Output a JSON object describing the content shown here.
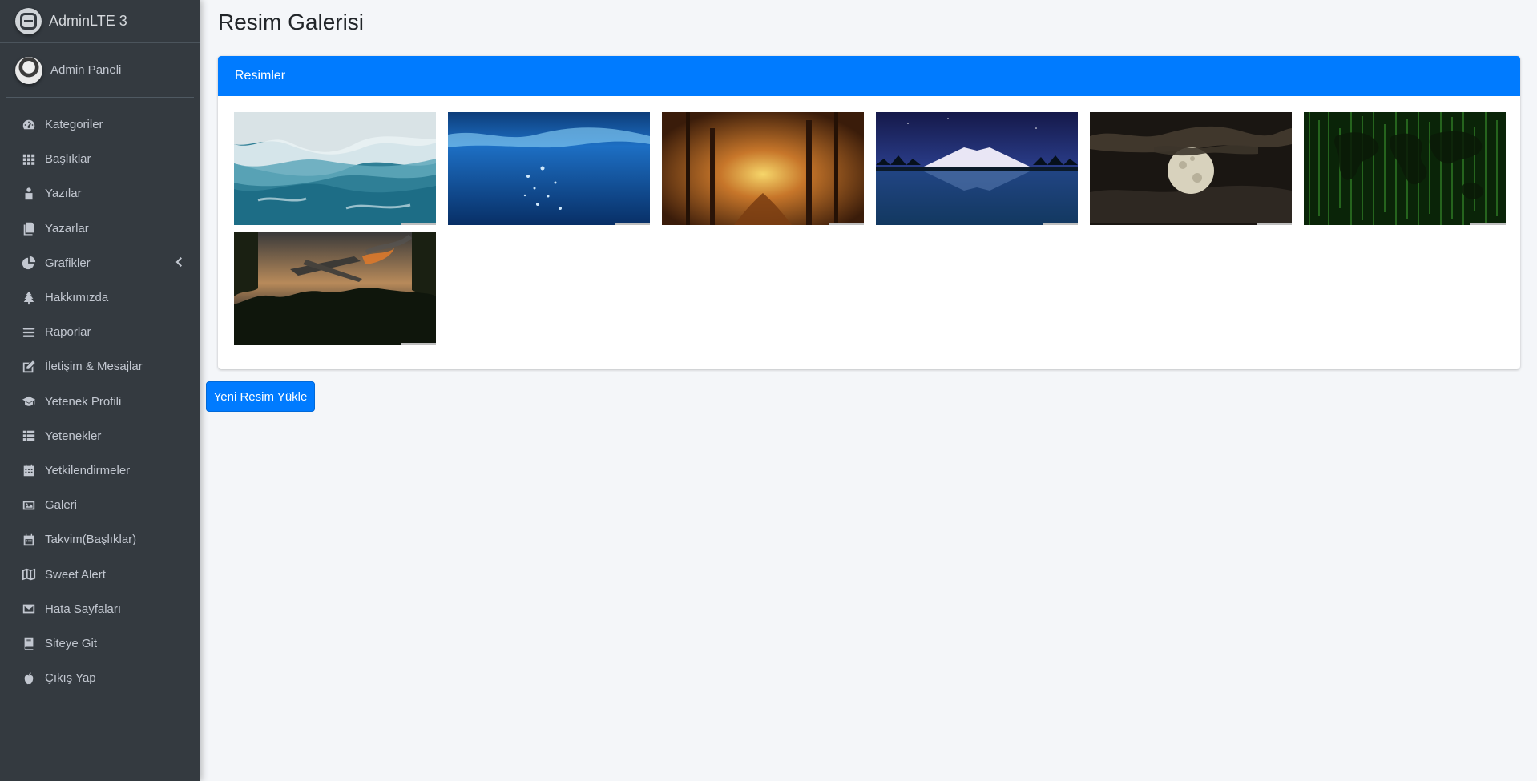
{
  "brand": {
    "name": "AdminLTE 3"
  },
  "user": {
    "name": "Admin Paneli"
  },
  "sidebar": {
    "items": [
      {
        "label": "Kategoriler",
        "icon": "tachometer-icon"
      },
      {
        "label": "Başlıklar",
        "icon": "grid-icon"
      },
      {
        "label": "Yazılar",
        "icon": "person-icon"
      },
      {
        "label": "Yazarlar",
        "icon": "copy-icon"
      },
      {
        "label": "Grafikler",
        "icon": "pie-chart-icon",
        "has_submenu": true
      },
      {
        "label": "Hakkımızda",
        "icon": "tree-icon"
      },
      {
        "label": "Raporlar",
        "icon": "bars-icon"
      },
      {
        "label": "İletişim & Mesajlar",
        "icon": "edit-icon"
      },
      {
        "label": "Yetenek Profili",
        "icon": "graduation-cap-icon"
      },
      {
        "label": "Yetenekler",
        "icon": "table-icon"
      },
      {
        "label": "Yetkilendirmeler",
        "icon": "calendar-grid-icon"
      },
      {
        "label": "Galeri",
        "icon": "image-icon"
      },
      {
        "label": "Takvim(Başlıklar)",
        "icon": "calendar-icon"
      },
      {
        "label": "Sweet Alert",
        "icon": "map-icon"
      },
      {
        "label": "Hata Sayfaları",
        "icon": "envelope-icon"
      },
      {
        "label": "Siteye Git",
        "icon": "book-icon"
      },
      {
        "label": "Çıkış Yap",
        "icon": "apple-icon"
      }
    ]
  },
  "page": {
    "title": "Resim Galerisi"
  },
  "card": {
    "title": "Resimler"
  },
  "gallery": {
    "images": [
      {
        "name": "ocean-waves-image"
      },
      {
        "name": "underwater-image"
      },
      {
        "name": "autumn-forest-image"
      },
      {
        "name": "mountain-lake-image"
      },
      {
        "name": "moon-night-image"
      },
      {
        "name": "matrix-world-map-image"
      },
      {
        "name": "plane-crash-image"
      }
    ]
  },
  "actions": {
    "upload_label": "Yeni Resim Yükle"
  },
  "colors": {
    "sidebar_bg": "#343a40",
    "primary": "#007bff",
    "content_bg": "#f4f6f9"
  }
}
